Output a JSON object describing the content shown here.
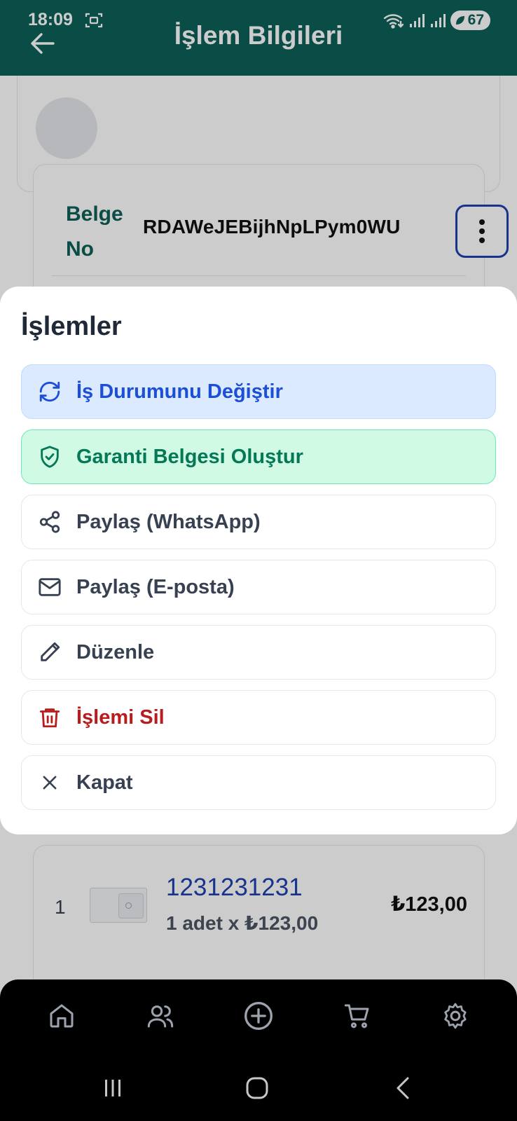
{
  "status_bar": {
    "time": "18:09",
    "battery": "67"
  },
  "header": {
    "title": "İşlem Bilgileri"
  },
  "document": {
    "label": "Belge No",
    "number": "RDAWeJEBijhNpLPym0WU"
  },
  "item": {
    "index": "1",
    "name": "1231231231",
    "quantity": "1 adet x ₺123,00",
    "price": "₺123,00"
  },
  "sheet": {
    "title": "İşlemler",
    "actions": [
      {
        "label": "İş Durumunu Değiştir",
        "icon": "refresh-icon"
      },
      {
        "label": "Garanti Belgesi Oluştur",
        "icon": "shield-check-icon"
      },
      {
        "label": "Paylaş (WhatsApp)",
        "icon": "share-icon"
      },
      {
        "label": "Paylaş (E-posta)",
        "icon": "mail-icon"
      },
      {
        "label": "Düzenle",
        "icon": "pencil-icon"
      },
      {
        "label": "İşlemi Sil",
        "icon": "trash-icon"
      },
      {
        "label": "Kapat",
        "icon": "close-icon"
      }
    ]
  },
  "bottom_nav": {
    "items": [
      "home-icon",
      "users-icon",
      "plus-circle-icon",
      "cart-icon",
      "settings-icon"
    ]
  },
  "colors": {
    "header": "#0d5f58",
    "primary": "#1d4ed8",
    "success": "#047857",
    "danger": "#b91c1c"
  }
}
